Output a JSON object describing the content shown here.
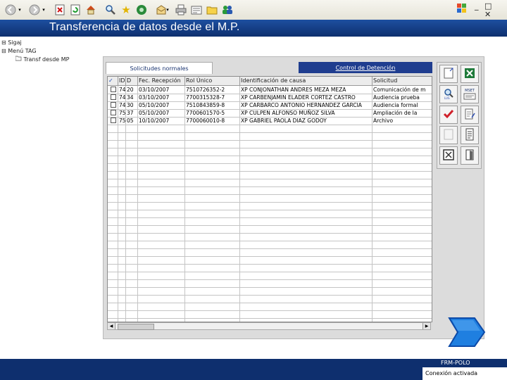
{
  "window": {
    "title": "Transferencia de datos desde el M.P.",
    "controls": [
      "_",
      "□",
      "✕"
    ]
  },
  "toolbar": {
    "icons": [
      "back-icon",
      "forward-icon",
      "stop-icon",
      "refresh-icon",
      "home-icon",
      "search-icon",
      "favorites-icon",
      "media-icon",
      "history-icon",
      "mail-icon",
      "print-icon",
      "edit-icon",
      "folder-icon",
      "messenger-icon"
    ]
  },
  "tree": {
    "items": [
      {
        "label": "Sigaj",
        "expander": "⊟"
      },
      {
        "label": "Menú TAG",
        "expander": "⊟"
      },
      {
        "label": "Transf desde MP",
        "expander": ""
      }
    ]
  },
  "tabs": [
    {
      "label": "Solicitudes normales",
      "active": true
    },
    {
      "label": "Control de Detención",
      "active": false
    }
  ],
  "table": {
    "columns": [
      "✓",
      "ID",
      "D",
      "Fec. Recepción",
      "Rol Único",
      "Identificación de causa",
      "Solicitud"
    ],
    "rows": [
      {
        "id": "74",
        "d": "20",
        "date": "03/10/2007",
        "rol": "7510726352-2",
        "causa": "XP CONJONATHAN ANDRES MEZA MEZA",
        "solicitud": "Comunicación de m"
      },
      {
        "id": "74",
        "d": "34",
        "date": "03/10/2007",
        "rol": "7700315328-7",
        "causa": "XP CARBENJAMIN ELADER CORTEZ CASTRO",
        "solicitud": "Audiencia prueba"
      },
      {
        "id": "74",
        "d": "30",
        "date": "05/10/2007",
        "rol": "7510843859-8",
        "causa": "XP CARBARCO ANTONIO HERNANDEZ GARCIA",
        "solicitud": "Audiencia formal"
      },
      {
        "id": "75",
        "d": "37",
        "date": "05/10/2007",
        "rol": "7700601570-5",
        "causa": "XP CULPEN ALFONSO MUÑOZ SILVA",
        "solicitud": "Ampliación de la"
      },
      {
        "id": "75",
        "d": "05",
        "date": "10/10/2007",
        "rol": "7700060010-8",
        "causa": "XP GABRIEL PAOLA DIAZ GODOY",
        "solicitud": "Archivo"
      }
    ],
    "empty_rows": 27
  },
  "side_buttons": [
    {
      "icon": "new-document-icon"
    },
    {
      "icon": "excel-icon"
    },
    {
      "icon": "magnifier-icon"
    },
    {
      "icon": "mset-icon",
      "label": "MSET"
    },
    {
      "icon": "red-check-icon"
    },
    {
      "icon": "edit-document-icon"
    },
    {
      "icon": "blank-document-icon"
    },
    {
      "icon": "list-document-icon"
    },
    {
      "icon": "close-box-icon"
    },
    {
      "icon": "exit-door-icon"
    }
  ],
  "status": {
    "user": "FRM-POLO",
    "message": "Conexión activada"
  },
  "colors": {
    "title_bar": "#1d4fa0",
    "status_bar": "#0e2f6e",
    "next_arrow": "#1f7fe0"
  }
}
